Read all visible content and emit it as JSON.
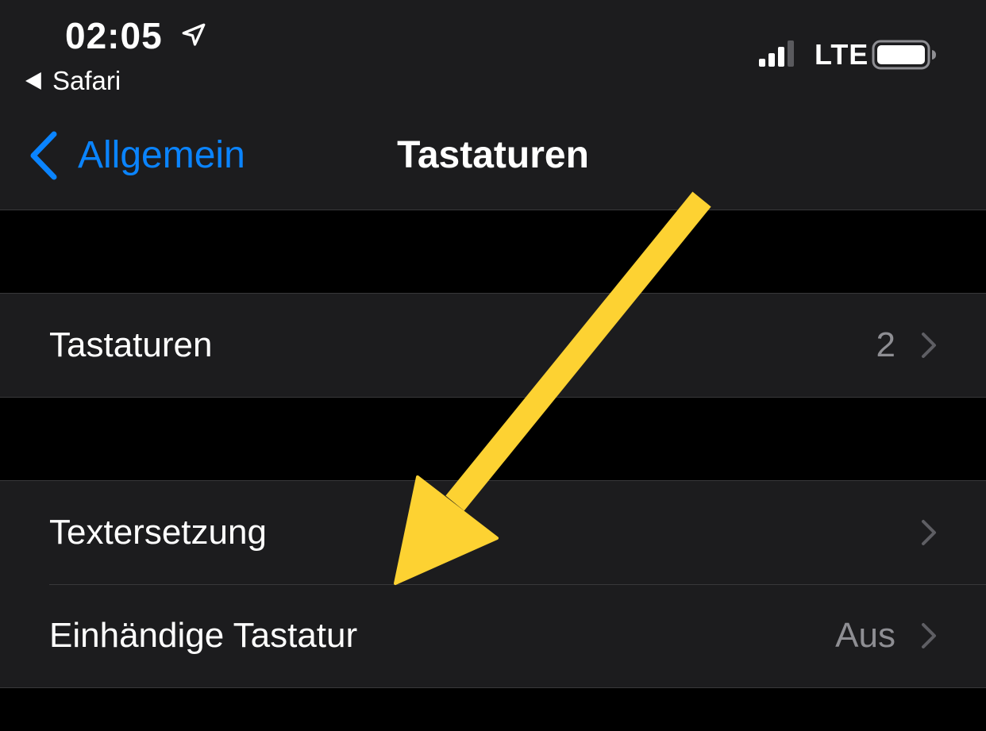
{
  "status_bar": {
    "time": "02:05",
    "back_app_label": "Safari",
    "network": "LTE",
    "icons": {
      "location": "location-arrow-icon",
      "signal": "cellular-signal-icon",
      "battery": "battery-icon"
    },
    "signal_bars_filled": 3,
    "battery_level": 1.0
  },
  "nav": {
    "back_label": "Allgemein",
    "title": "Tastaturen",
    "back_icon": "chevron-left-icon"
  },
  "groups": [
    {
      "rows": [
        {
          "label": "Tastaturen",
          "value": "2"
        }
      ]
    },
    {
      "rows": [
        {
          "label": "Textersetzung",
          "value": ""
        },
        {
          "label": "Einhändige Tastatur",
          "value": "Aus"
        }
      ]
    }
  ],
  "annotation": {
    "type": "arrow",
    "color": "#fdd232"
  },
  "colors": {
    "accent": "#0a84ff",
    "background": "#000000",
    "cell_background": "#1c1c1e",
    "separator": "#38383a",
    "secondary_text": "#8e8e93"
  }
}
